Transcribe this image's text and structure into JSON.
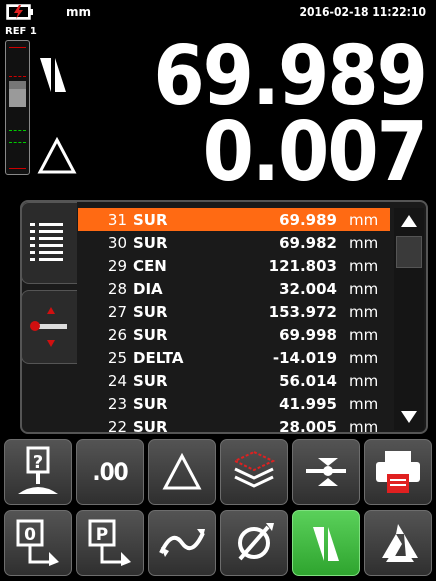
{
  "status": {
    "unit": "mm",
    "datetime": "2016-02-18 11:22:10"
  },
  "display": {
    "ref_label": "REF 1",
    "value1": "69.989",
    "value2": "0.007"
  },
  "list": {
    "rows": [
      {
        "n": "31",
        "type": "SUR",
        "value": "69.989",
        "unit": "mm",
        "selected": true
      },
      {
        "n": "30",
        "type": "SUR",
        "value": "69.982",
        "unit": "mm"
      },
      {
        "n": "29",
        "type": "CEN",
        "value": "121.803",
        "unit": "mm"
      },
      {
        "n": "28",
        "type": "DIA",
        "value": "32.004",
        "unit": "mm"
      },
      {
        "n": "27",
        "type": "SUR",
        "value": "153.972",
        "unit": "mm"
      },
      {
        "n": "26",
        "type": "SUR",
        "value": "69.998",
        "unit": "mm"
      },
      {
        "n": "25",
        "type": "DELTA",
        "value": "-14.019",
        "unit": "mm"
      },
      {
        "n": "24",
        "type": "SUR",
        "value": "56.014",
        "unit": "mm"
      },
      {
        "n": "23",
        "type": "SUR",
        "value": "41.995",
        "unit": "mm"
      },
      {
        "n": "22",
        "type": "SUR",
        "value": "28.005",
        "unit": "mm"
      }
    ]
  },
  "toolbar": {
    "decimals_label": ".00"
  },
  "colors": {
    "selected_row": "#ff6a13",
    "active_button": "#3cb83c",
    "printer_red": "#e02020",
    "battery_red": "#e02020"
  },
  "icons": [
    "battery-icon",
    "absolute-mode-icon",
    "incremental-delta-icon",
    "list-view-icon",
    "point-probe-icon",
    "help-icon",
    "decimals-icon",
    "delta-icon",
    "layers-icon",
    "probe-target-icon",
    "printer-icon",
    "zero-icon",
    "preset-icon",
    "wave-icon",
    "diameter-icon",
    "absolute-active-icon",
    "calibrate-icon"
  ]
}
